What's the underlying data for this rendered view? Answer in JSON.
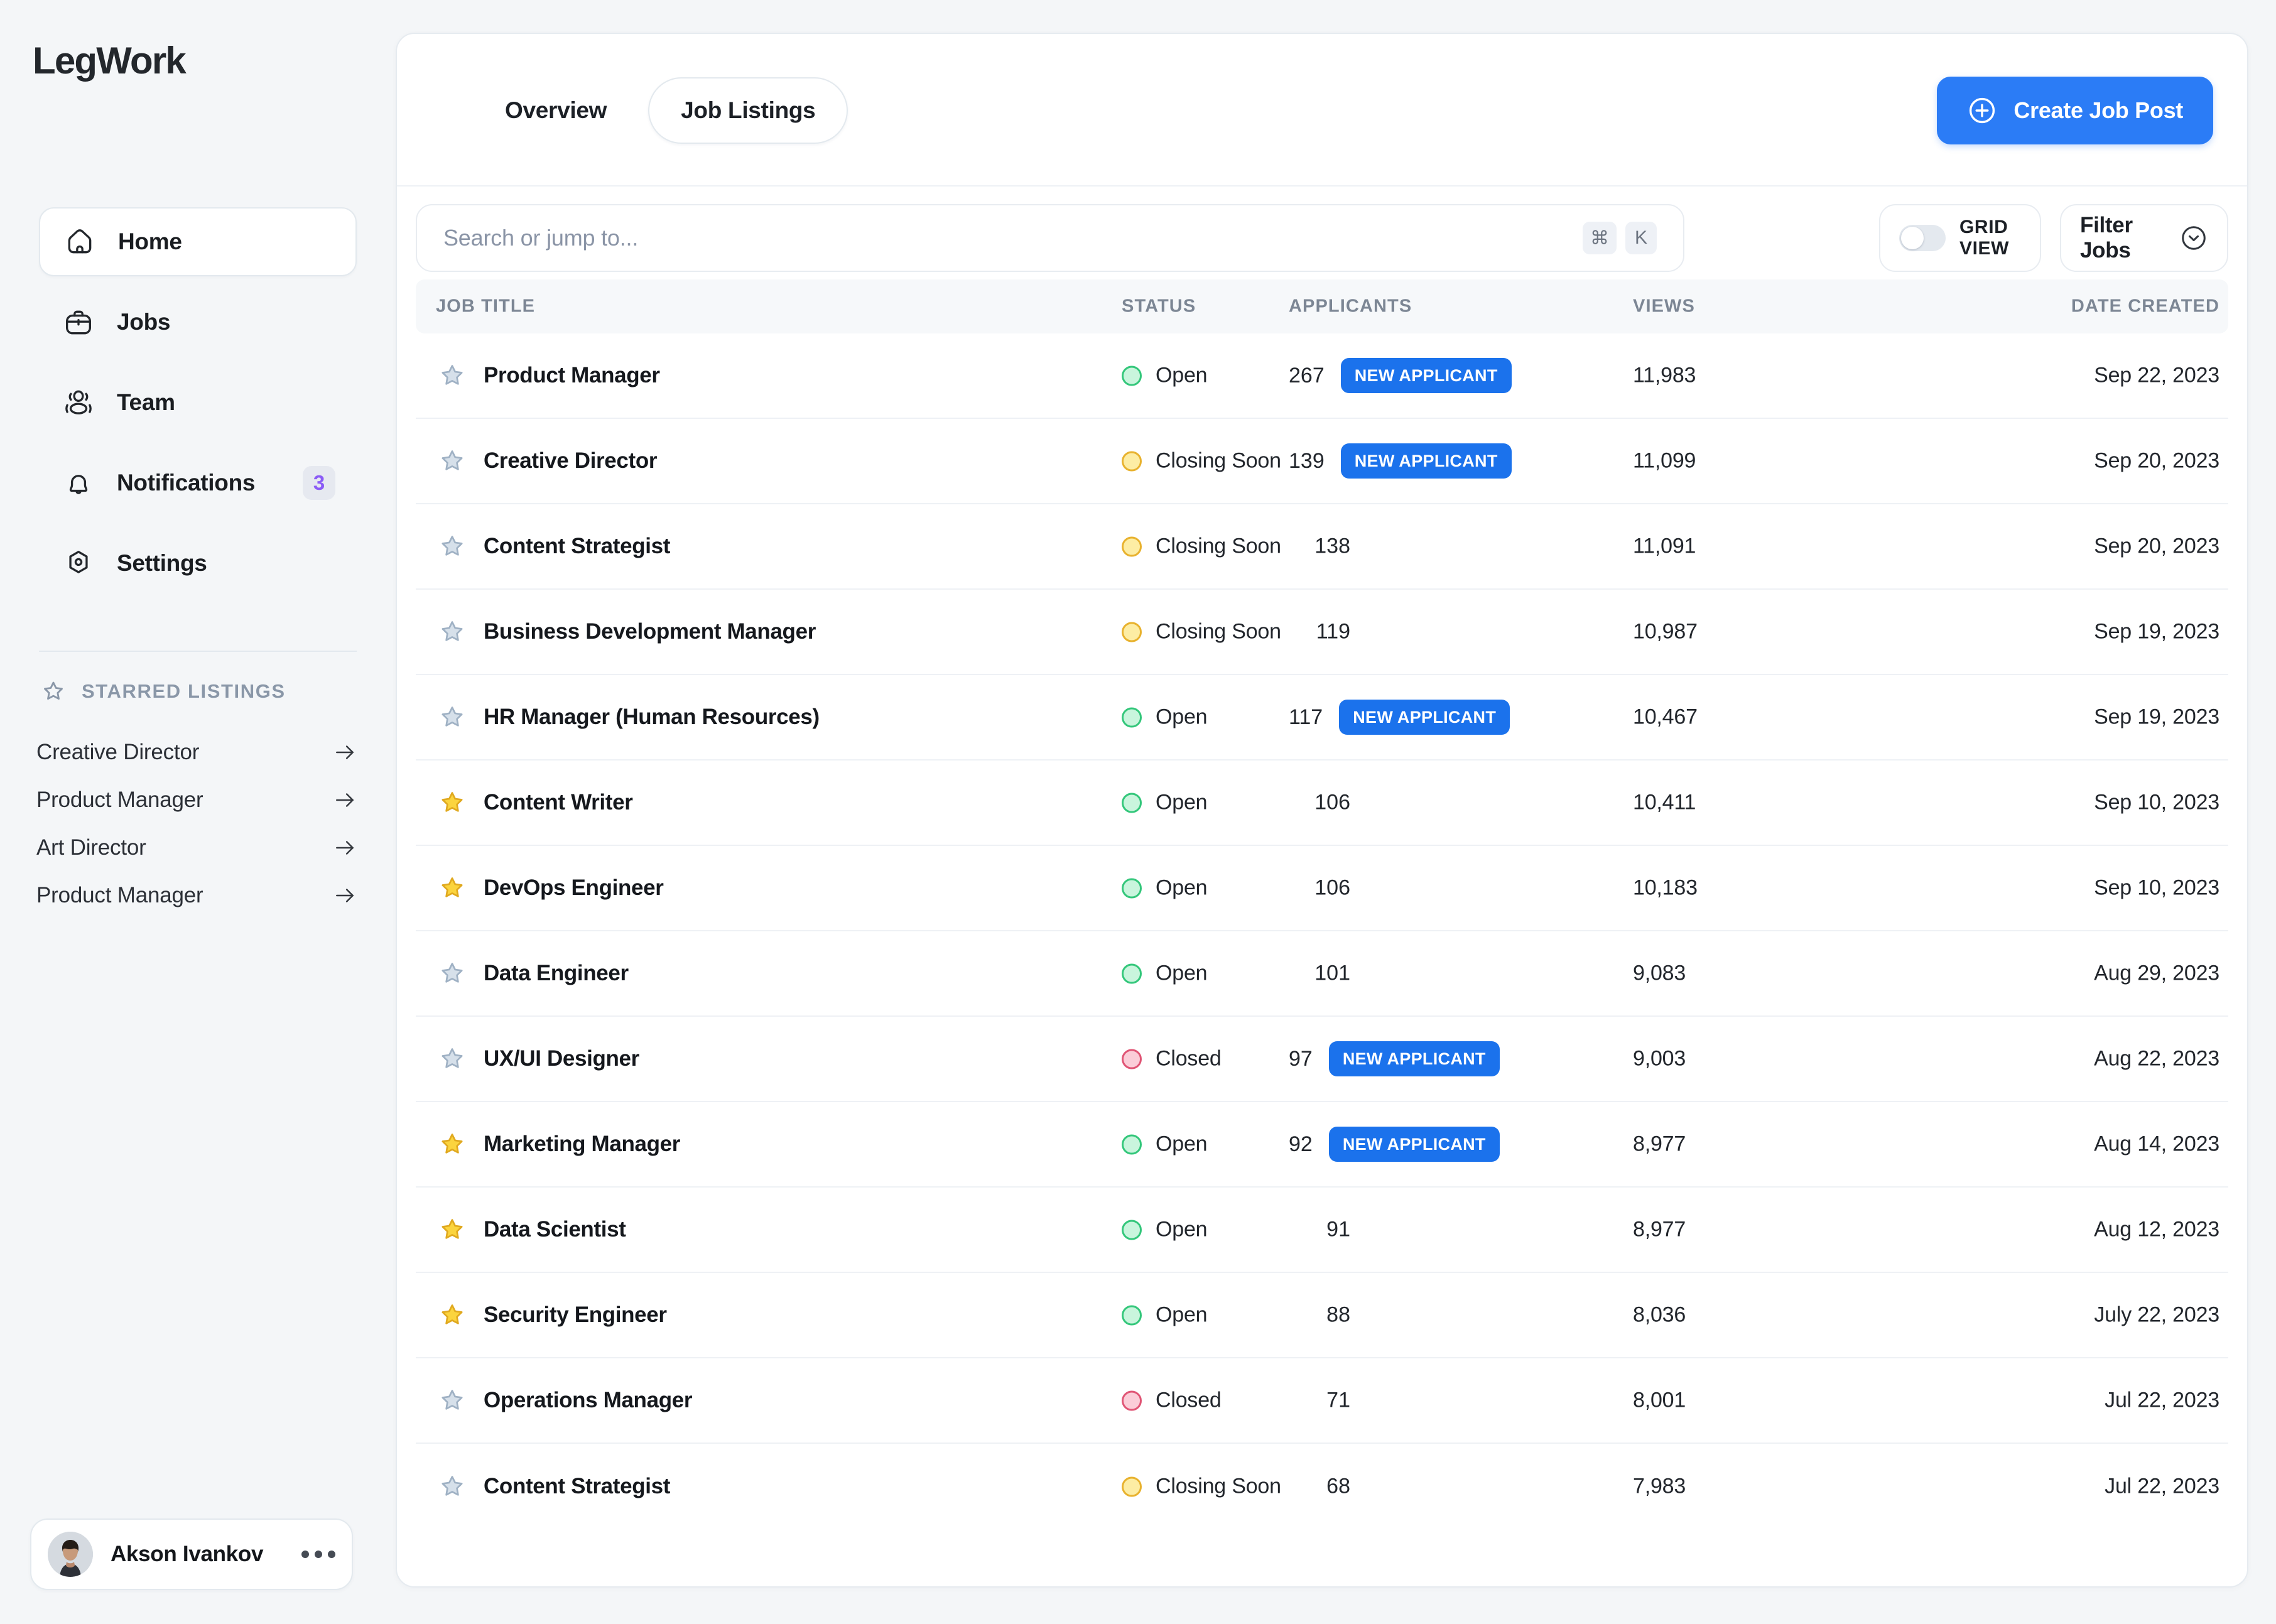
{
  "brand": {
    "name": "LegWork"
  },
  "sidebar": {
    "nav_items": [
      {
        "label": "Home",
        "icon": "home-icon",
        "active": true,
        "badge": null
      },
      {
        "label": "Jobs",
        "icon": "briefcase-icon",
        "active": false,
        "badge": null
      },
      {
        "label": "Team",
        "icon": "people-icon",
        "active": false,
        "badge": null
      },
      {
        "label": "Notifications",
        "icon": "bell-icon",
        "active": false,
        "badge": "3"
      },
      {
        "label": "Settings",
        "icon": "settings-gear-icon",
        "active": false,
        "badge": null
      }
    ],
    "starred": {
      "title": "STARRED LISTINGS",
      "items": [
        {
          "label": "Creative Director"
        },
        {
          "label": "Product Manager"
        },
        {
          "label": "Art Director"
        },
        {
          "label": "Product Manager"
        }
      ]
    },
    "user": {
      "name": "Akson Ivankov"
    }
  },
  "header": {
    "tabs": [
      {
        "label": "Overview",
        "active": false
      },
      {
        "label": "Job Listings",
        "active": true
      }
    ],
    "create_button": {
      "label": "Create Job Post"
    }
  },
  "toolbar": {
    "search": {
      "placeholder": "Search or jump to...",
      "value": ""
    },
    "shortcut_keys": [
      "⌘",
      "K"
    ],
    "grid_view": {
      "label": "GRID VIEW",
      "enabled": false
    },
    "filter": {
      "label": "Filter Jobs"
    }
  },
  "table": {
    "columns": [
      "JOB TITLE",
      "STATUS",
      "APPLICANTS",
      "VIEWS",
      "DATE CREATED"
    ],
    "rows": [
      {
        "starred": false,
        "title": "Product Manager",
        "status": "Open",
        "status_kind": "open",
        "applicants": "267",
        "new_applicant": true,
        "new_applicant_label": "NEW APPLICANT",
        "views": "11,983",
        "date": "Sep 22, 2023"
      },
      {
        "starred": false,
        "title": "Creative Director",
        "status": "Closing Soon",
        "status_kind": "closing",
        "applicants": "139",
        "new_applicant": true,
        "new_applicant_label": "NEW APPLICANT",
        "views": "11,099",
        "date": "Sep 20, 2023"
      },
      {
        "starred": false,
        "title": "Content Strategist",
        "status": "Closing Soon",
        "status_kind": "closing",
        "applicants": "138",
        "new_applicant": false,
        "new_applicant_label": "NEW APPLICANT",
        "views": "11,091",
        "date": "Sep 20, 2023"
      },
      {
        "starred": false,
        "title": "Business Development Manager",
        "status": "Closing Soon",
        "status_kind": "closing",
        "applicants": "119",
        "new_applicant": false,
        "new_applicant_label": "NEW APPLICANT",
        "views": "10,987",
        "date": "Sep 19, 2023"
      },
      {
        "starred": false,
        "title": "HR Manager (Human Resources)",
        "status": "Open",
        "status_kind": "open",
        "applicants": "117",
        "new_applicant": true,
        "new_applicant_label": "NEW APPLICANT",
        "views": "10,467",
        "date": "Sep 19, 2023"
      },
      {
        "starred": true,
        "title": "Content Writer",
        "status": "Open",
        "status_kind": "open",
        "applicants": "106",
        "new_applicant": false,
        "new_applicant_label": "NEW APPLICANT",
        "views": "10,411",
        "date": "Sep 10, 2023"
      },
      {
        "starred": true,
        "title": "DevOps Engineer",
        "status": "Open",
        "status_kind": "open",
        "applicants": "106",
        "new_applicant": false,
        "new_applicant_label": "NEW APPLICANT",
        "views": "10,183",
        "date": "Sep 10, 2023"
      },
      {
        "starred": false,
        "title": "Data Engineer",
        "status": "Open",
        "status_kind": "open",
        "applicants": "101",
        "new_applicant": false,
        "new_applicant_label": "NEW APPLICANT",
        "views": "9,083",
        "date": "Aug 29, 2023"
      },
      {
        "starred": false,
        "title": "UX/UI Designer",
        "status": "Closed",
        "status_kind": "closed",
        "applicants": "97",
        "new_applicant": true,
        "new_applicant_label": "NEW APPLICANT",
        "views": "9,003",
        "date": "Aug 22, 2023"
      },
      {
        "starred": true,
        "title": "Marketing Manager",
        "status": "Open",
        "status_kind": "open",
        "applicants": "92",
        "new_applicant": true,
        "new_applicant_label": "NEW APPLICANT",
        "views": "8,977",
        "date": "Aug 14, 2023"
      },
      {
        "starred": true,
        "title": "Data Scientist",
        "status": "Open",
        "status_kind": "open",
        "applicants": "91",
        "new_applicant": false,
        "new_applicant_label": "NEW APPLICANT",
        "views": "8,977",
        "date": "Aug 12, 2023"
      },
      {
        "starred": true,
        "title": "Security Engineer",
        "status": "Open",
        "status_kind": "open",
        "applicants": "88",
        "new_applicant": false,
        "new_applicant_label": "NEW APPLICANT",
        "views": "8,036",
        "date": "July 22, 2023"
      },
      {
        "starred": false,
        "title": "Operations Manager",
        "status": "Closed",
        "status_kind": "closed",
        "applicants": "71",
        "new_applicant": false,
        "new_applicant_label": "NEW APPLICANT",
        "views": "8,001",
        "date": "Jul 22, 2023"
      },
      {
        "starred": false,
        "title": "Content Strategist",
        "status": "Closing Soon",
        "status_kind": "closing",
        "applicants": "68",
        "new_applicant": false,
        "new_applicant_label": "NEW APPLICANT",
        "views": "7,983",
        "date": "Jul 22, 2023"
      }
    ]
  },
  "colors": {
    "accent_blue": "#2b7cf6",
    "badge_blue": "#1b72ec",
    "status_open": "#34c77b",
    "status_closing": "#e8b22e",
    "status_closed": "#e05575",
    "star_active": "#fbd43e",
    "star_inactive": "#cfdae6",
    "notification_count": "#8b5cf6",
    "page_bg": "#f4f6f8"
  }
}
